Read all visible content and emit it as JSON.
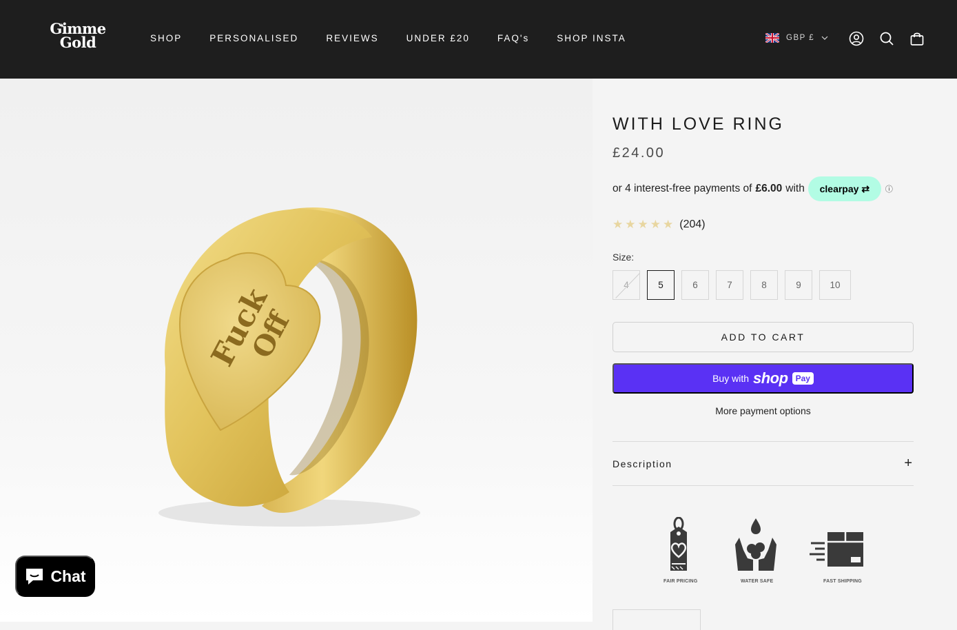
{
  "header": {
    "logo_line1": "Gimme",
    "logo_line2": "Gold",
    "nav": [
      "SHOP",
      "PERSONALISED",
      "REVIEWS",
      "UNDER £20",
      "FAQ's",
      "SHOP INSTA"
    ],
    "currency": "GBP £",
    "icons": [
      "flag-uk-icon",
      "chevron-down-icon",
      "account-icon",
      "search-icon",
      "cart-icon"
    ]
  },
  "product": {
    "engraving_line1": "Fuck",
    "engraving_line2": "Off",
    "title": "WITH LOVE RING",
    "price": "£24.00",
    "clearpay": {
      "prefix": "or 4 interest-free payments of",
      "amount": "£6.00",
      "suffix": "with",
      "brand": "clearpay",
      "info": "ⓘ"
    },
    "rating": {
      "stars": 5,
      "count": "(204)"
    },
    "size_label": "Size:",
    "sizes": [
      "4",
      "5",
      "6",
      "7",
      "8",
      "9",
      "10"
    ],
    "selected_size": "5",
    "sold_out_sizes": [
      "4"
    ],
    "add_to_cart": "ADD TO CART",
    "buy_with": "Buy with",
    "shop_word": "shop",
    "pay_word": "Pay",
    "more_payment": "More payment options",
    "description_label": "Description",
    "description_toggle": "+",
    "badges": [
      "FAIR PRICING",
      "WATER SAFE",
      "FAST SHIPPING"
    ]
  },
  "chat": {
    "label": "Chat"
  },
  "colors": {
    "header_bg": "#1e1e1e",
    "shop_pay": "#5a31f4",
    "clearpay_badge": "#b2fce4",
    "star": "#e8d6a0",
    "gold": "#d9b84a"
  }
}
